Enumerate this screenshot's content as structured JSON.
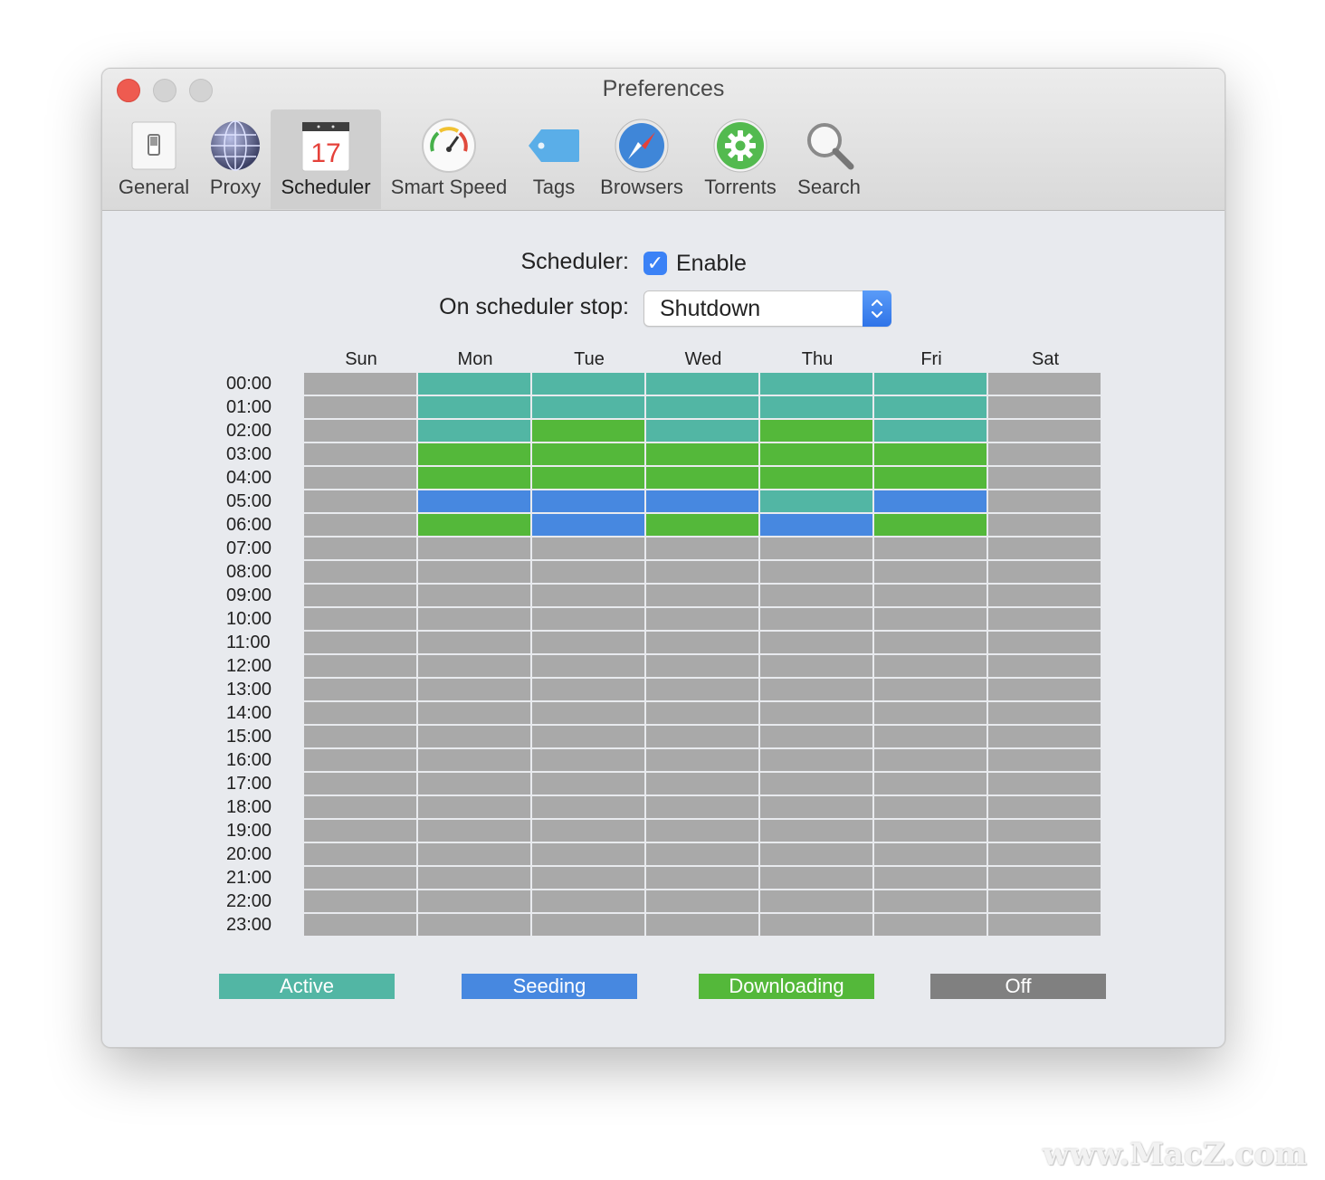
{
  "window": {
    "title": "Preferences"
  },
  "toolbar": {
    "items": [
      {
        "label": "General",
        "icon": "switch-icon"
      },
      {
        "label": "Proxy",
        "icon": "globe-icon"
      },
      {
        "label": "Scheduler",
        "icon": "calendar-icon",
        "icon_text": "17",
        "selected": true
      },
      {
        "label": "Smart Speed",
        "icon": "speedometer-icon"
      },
      {
        "label": "Tags",
        "icon": "tag-icon"
      },
      {
        "label": "Browsers",
        "icon": "compass-icon"
      },
      {
        "label": "Torrents",
        "icon": "gear-icon"
      },
      {
        "label": "Search",
        "icon": "magnifier-icon"
      }
    ]
  },
  "scheduler": {
    "label": "Scheduler:",
    "enable_label": "Enable",
    "enabled": true,
    "checkmark": "✓",
    "stop_label": "On scheduler stop:",
    "stop_value": "Shutdown"
  },
  "grid": {
    "days": [
      "Sun",
      "Mon",
      "Tue",
      "Wed",
      "Thu",
      "Fri",
      "Sat"
    ],
    "hours": [
      "00:00",
      "01:00",
      "02:00",
      "03:00",
      "04:00",
      "05:00",
      "06:00",
      "07:00",
      "08:00",
      "09:00",
      "10:00",
      "11:00",
      "12:00",
      "13:00",
      "14:00",
      "15:00",
      "16:00",
      "17:00",
      "18:00",
      "19:00",
      "20:00",
      "21:00",
      "22:00",
      "23:00"
    ],
    "schedule": [
      [
        "O",
        "A",
        "A",
        "A",
        "A",
        "A",
        "O"
      ],
      [
        "O",
        "A",
        "A",
        "A",
        "A",
        "A",
        "O"
      ],
      [
        "O",
        "A",
        "D",
        "A",
        "D",
        "A",
        "O"
      ],
      [
        "O",
        "D",
        "D",
        "D",
        "D",
        "D",
        "O"
      ],
      [
        "O",
        "D",
        "D",
        "D",
        "D",
        "D",
        "O"
      ],
      [
        "O",
        "S",
        "S",
        "S",
        "A",
        "S",
        "O"
      ],
      [
        "O",
        "D",
        "S",
        "D",
        "S",
        "D",
        "O"
      ],
      [
        "O",
        "O",
        "O",
        "O",
        "O",
        "O",
        "O"
      ],
      [
        "O",
        "O",
        "O",
        "O",
        "O",
        "O",
        "O"
      ],
      [
        "O",
        "O",
        "O",
        "O",
        "O",
        "O",
        "O"
      ],
      [
        "O",
        "O",
        "O",
        "O",
        "O",
        "O",
        "O"
      ],
      [
        "O",
        "O",
        "O",
        "O",
        "O",
        "O",
        "O"
      ],
      [
        "O",
        "O",
        "O",
        "O",
        "O",
        "O",
        "O"
      ],
      [
        "O",
        "O",
        "O",
        "O",
        "O",
        "O",
        "O"
      ],
      [
        "O",
        "O",
        "O",
        "O",
        "O",
        "O",
        "O"
      ],
      [
        "O",
        "O",
        "O",
        "O",
        "O",
        "O",
        "O"
      ],
      [
        "O",
        "O",
        "O",
        "O",
        "O",
        "O",
        "O"
      ],
      [
        "O",
        "O",
        "O",
        "O",
        "O",
        "O",
        "O"
      ],
      [
        "O",
        "O",
        "O",
        "O",
        "O",
        "O",
        "O"
      ],
      [
        "O",
        "O",
        "O",
        "O",
        "O",
        "O",
        "O"
      ],
      [
        "O",
        "O",
        "O",
        "O",
        "O",
        "O",
        "O"
      ],
      [
        "O",
        "O",
        "O",
        "O",
        "O",
        "O",
        "O"
      ],
      [
        "O",
        "O",
        "O",
        "O",
        "O",
        "O",
        "O"
      ],
      [
        "O",
        "O",
        "O",
        "O",
        "O",
        "O",
        "O"
      ]
    ],
    "state_colors": {
      "A": "#52b6a4",
      "S": "#4788e0",
      "D": "#54b83a",
      "O": "#a9a9a9"
    }
  },
  "legend": [
    {
      "label": "Active",
      "color": "#52b6a4"
    },
    {
      "label": "Seeding",
      "color": "#4788e0"
    },
    {
      "label": "Downloading",
      "color": "#54b83a"
    },
    {
      "label": "Off",
      "color": "#808080"
    }
  ],
  "watermark": "www.MacZ.com"
}
